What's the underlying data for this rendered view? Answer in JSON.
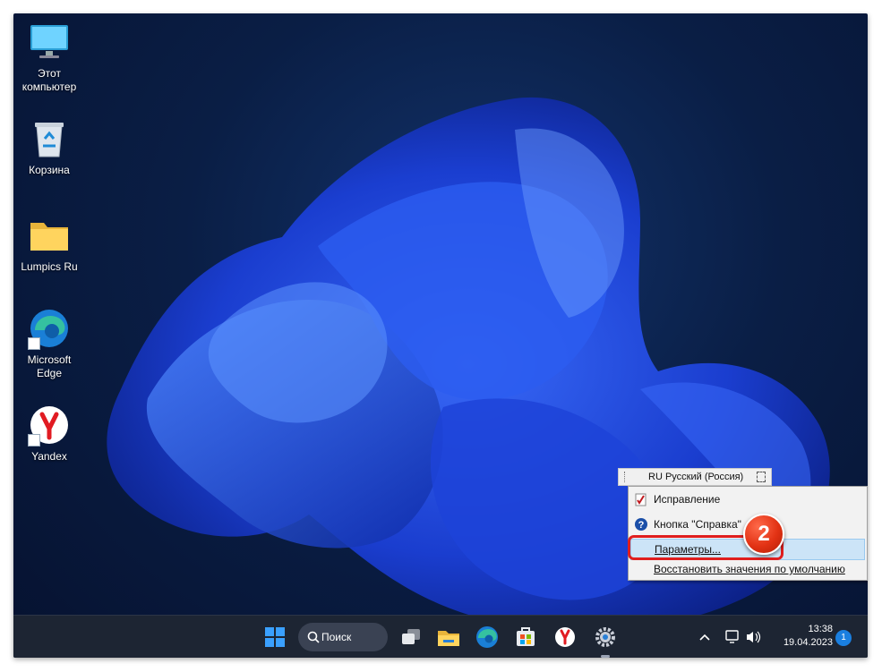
{
  "desktop": {
    "icons": [
      {
        "label": "Этот\nкомпьютер",
        "icon": "monitor-icon"
      },
      {
        "label": "Корзина",
        "icon": "recycle-bin-icon"
      },
      {
        "label": "Lumpics Ru",
        "icon": "folder-icon"
      },
      {
        "label": "Microsoft\nEdge",
        "icon": "edge-icon"
      },
      {
        "label": "Yandex",
        "icon": "yandex-icon"
      }
    ]
  },
  "language_bar": {
    "text": "RU Русский (Россия)"
  },
  "context_menu": {
    "items": [
      {
        "label": "Исправление",
        "icon": "repair-icon"
      },
      {
        "label": "Кнопка \"Справка\"",
        "icon": "help-icon"
      },
      {
        "label": "Параметры...",
        "icon": "none",
        "highlighted": true
      },
      {
        "label": "Восстановить значения по умолчанию",
        "icon": "none"
      }
    ]
  },
  "annotation": {
    "step_number": "2",
    "marker_color": "#e01e1e"
  },
  "taskbar": {
    "search_label": "Поиск",
    "apps": [
      "start-icon",
      "task-view-icon",
      "file-explorer-icon",
      "edge-icon",
      "store-icon",
      "yandex-icon",
      "settings-icon"
    ],
    "clock_time": "13:38",
    "clock_date": "19.04.2023",
    "notification_count": "1",
    "accent": "#1a7fe0"
  }
}
